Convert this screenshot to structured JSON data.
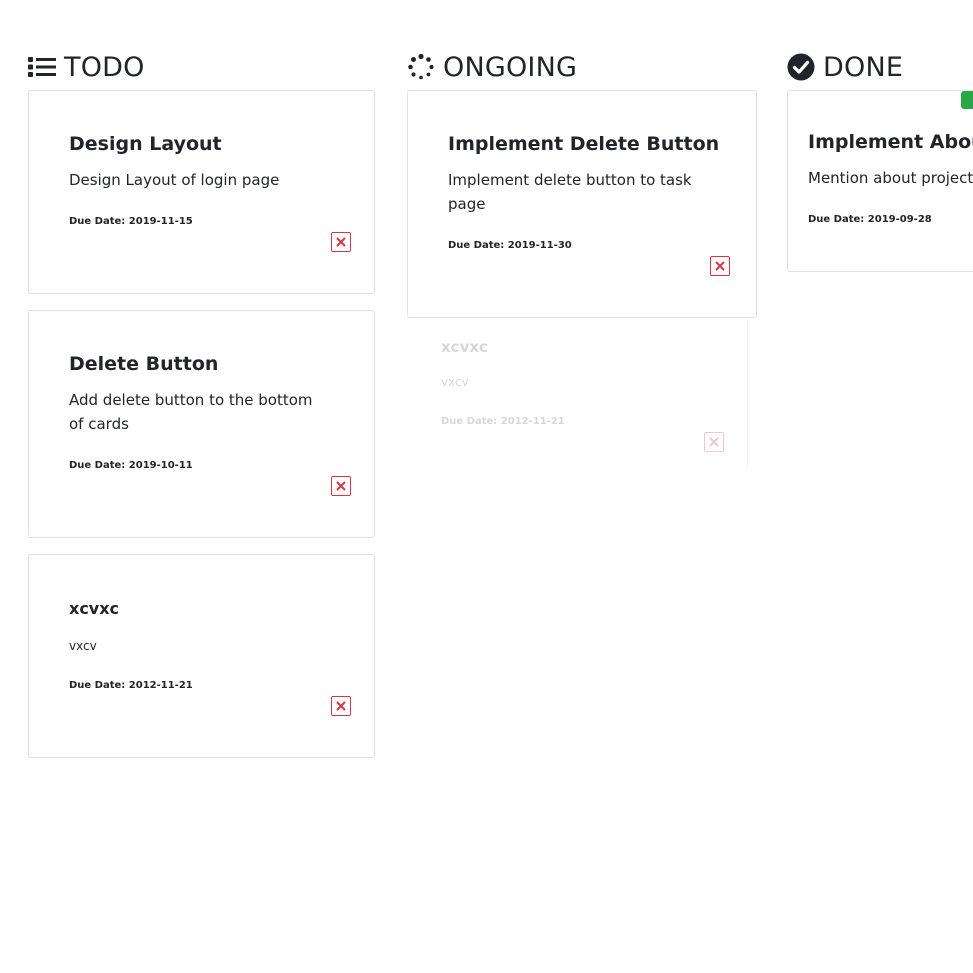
{
  "columns": {
    "todo": {
      "title": "TODO",
      "icon": "list-icon",
      "cards": [
        {
          "title": "Design Layout",
          "description": "Design Layout of login page",
          "due_label": "Due Date:",
          "due_value": "2019-11-15"
        },
        {
          "title": "Delete Button",
          "description": "Add delete button to the bottom of cards",
          "due_label": "Due Date:",
          "due_value": "2019-10-11"
        },
        {
          "title": "xcvxc",
          "description": "vxcv",
          "due_label": "Due Date:",
          "due_value": "2012-11-21"
        }
      ]
    },
    "ongoing": {
      "title": "ONGOING",
      "icon": "spinner-icon",
      "cards": [
        {
          "title": "Implement Delete Button",
          "description": "Implement delete button to task page",
          "due_label": "Due Date:",
          "due_value": "2019-11-30"
        }
      ],
      "dragging_card": {
        "title": "xcvxc",
        "description": "vxcv",
        "due_label": "Due Date:",
        "due_value": "2012-11-21"
      }
    },
    "done": {
      "title": "DONE",
      "icon": "check-circle-icon",
      "cards": [
        {
          "title": "Implement About",
          "description": "Mention about project a",
          "due_label": "Due Date:",
          "due_value": "2019-09-28"
        }
      ]
    }
  },
  "colors": {
    "danger": "#dc3545",
    "success": "#28a745",
    "border": "#dee2e6",
    "text": "#212529"
  }
}
